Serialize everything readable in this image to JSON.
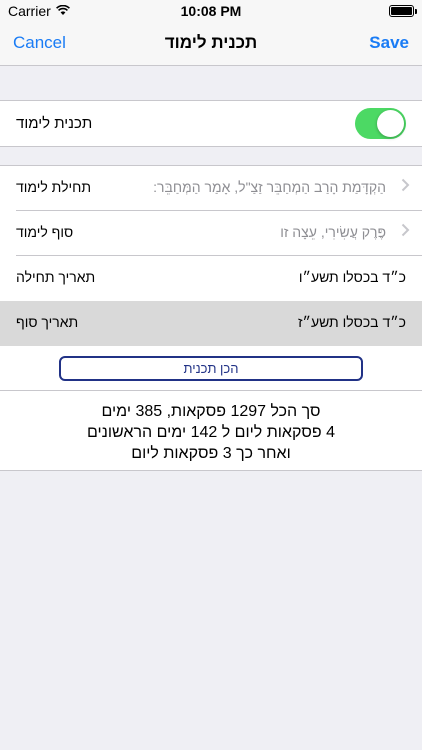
{
  "status_bar": {
    "carrier": "Carrier",
    "time": "10:08 PM",
    "battery_level": 1.0
  },
  "nav": {
    "cancel_label": "Cancel",
    "title": "תכנית לימוד",
    "save_label": "Save"
  },
  "toggle_row": {
    "label": "תכנית לימוד",
    "on": true
  },
  "rows": [
    {
      "label": "תחילת לימוד",
      "value": "הַקְדָּמַת הָרַב הַמְחַבֵּר זַצַ\"ל, אָמַר הַמְּחַבֵּר:"
    },
    {
      "label": "סוף לימוד",
      "value": "פֶּרֶק עֲשִׂירִי, עֵצָה זו"
    },
    {
      "label": "תאריך תחילה",
      "value": "כ״ד בכסלו תשע״ו"
    },
    {
      "label": "תאריך סוף",
      "value": "כ״ד בכסלו תשע״ז"
    }
  ],
  "plan_button_label": "הכן תכנית",
  "summary": [
    "סך הכל 1297 פסקאות, 385 ימים",
    "4 פסקאות ליום  ל 142 ימים הראשונים",
    "ואחר כך 3 פסקאות ליום"
  ],
  "colors": {
    "accent": "#1a7cf5",
    "toggle_on": "#4cd964",
    "button_border": "#213286",
    "selected_row": "#d9d9d9"
  }
}
